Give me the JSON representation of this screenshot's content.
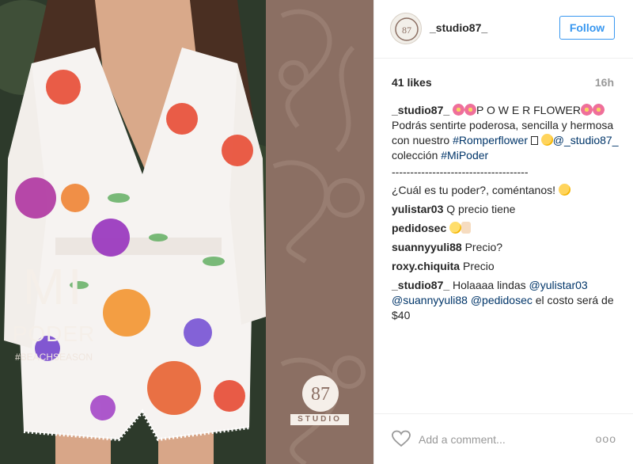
{
  "image": {
    "brand_text_1": "MI",
    "brand_text_2": "PODER",
    "brand_hashtag": "#BEACHSEASON",
    "logo_number": "87",
    "logo_word": "STUDIO"
  },
  "header": {
    "username": "_studio87_",
    "follow_label": "Follow"
  },
  "stats": {
    "likes": "41 likes",
    "time": "16h"
  },
  "caption": {
    "user": "_studio87_",
    "title": "P O W E R FLOWER",
    "line2": "Podrás sentirte poderosa, sencilla y hermosa con nuestro ",
    "tag_romper": "#Romperflower",
    "mention": "@_studio87_",
    "line3": " colección ",
    "tag_mipoder": "#MiPoder",
    "divider": "-------------------------------------",
    "question": "¿Cuál es tu poder?, coméntanos! "
  },
  "comments": [
    {
      "user": "yulistar03",
      "text": "Q precio tiene"
    },
    {
      "user": "pedidosec",
      "text": ""
    },
    {
      "user": "suannyyuli88",
      "text": "Precio?"
    },
    {
      "user": "roxy.chiquita",
      "text": "Precio"
    }
  ],
  "reply": {
    "user": "_studio87_",
    "text1": "Holaaaa lindas ",
    "m1": "@yulistar03",
    "m2": "@suannyyuli88",
    "m3": "@pedidosec",
    "text2": " el costo será de $40"
  },
  "footer": {
    "placeholder": "Add a comment...",
    "more": "ooo"
  },
  "colors": {
    "accent": "#3897f0",
    "link": "#003569",
    "brand_panel": "#8b6f63"
  },
  "icons": [
    "heart-icon",
    "more-options-icon",
    "avatar-logo"
  ]
}
